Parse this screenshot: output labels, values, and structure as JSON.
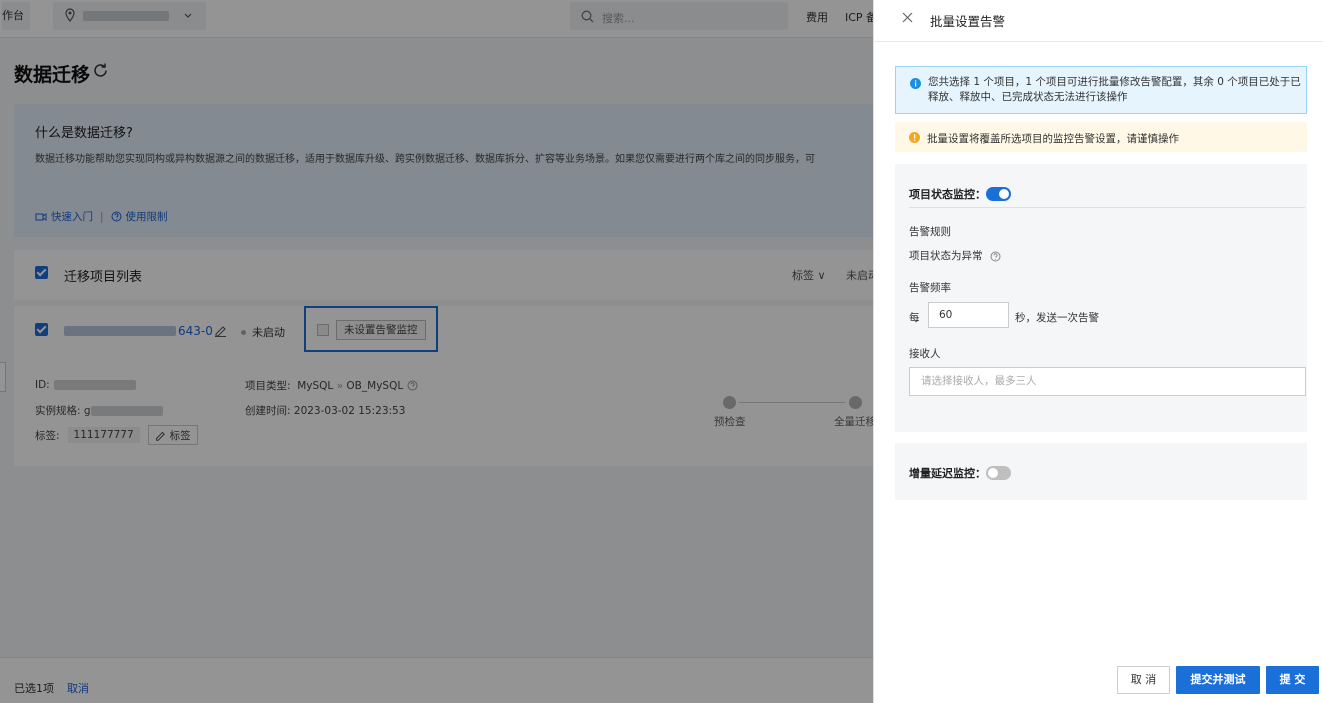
{
  "topbar": {
    "workbench_label": "作台",
    "search_placeholder": "搜索...",
    "fee_label": "费用",
    "icp_label": "ICP 备"
  },
  "page": {
    "title": "数据迁移",
    "intro": {
      "question": "什么是数据迁移?",
      "description": "数据迁移功能帮助您实现同构或异构数据源之间的数据迁移，适用于数据库升级、跨实例数据迁移、数据库拆分、扩容等业务场景。如果您仅需要进行两个库之间的同步服务，可",
      "link_quickstart": "快速入门",
      "link_limits": "使用限制"
    },
    "list": {
      "title": "迁移项目列表",
      "tags_filter": "标签",
      "status_filter": "未启动"
    },
    "project": {
      "name_suffix": "643-0",
      "status": "未启动",
      "alarm_tag": "未设置告警监控",
      "id_label": "ID:",
      "spec_label": "实例规格:",
      "spec_value_prefix": "g",
      "tags_label": "标签:",
      "tags_value": "111177777",
      "tag_button": "标签",
      "type_label": "项目类型:",
      "type_source": "MySQL",
      "type_arrow": "»",
      "type_target": "OB_MySQL",
      "created_label": "创建时间:",
      "created_value": "2023-03-02 15:23:53",
      "step1": "预检查",
      "step2": "全量迁移"
    },
    "footer": {
      "selected": "已选1项",
      "cancel": "取消"
    }
  },
  "drawer": {
    "title": "批量设置告警",
    "info": "您共选择 1 个项目，1 个项目可进行批量修改告警配置，其余 0 个项目已处于已释放、释放中、已完成状态无法进行该操作",
    "warning": "批量设置将覆盖所选项目的监控告警设置，请谨慎操作",
    "status_monitor_label": "项目状态监控：",
    "status_monitor_on": true,
    "rule_label": "告警规则",
    "rule_value": "项目状态为异常",
    "freq_label": "告警频率",
    "freq_prefix": "每",
    "freq_value": "60",
    "freq_suffix": "秒，发送一次告警",
    "receiver_label": "接收人",
    "receiver_placeholder": "请选择接收人，最多三人",
    "delay_monitor_label": "增量延迟监控：",
    "delay_monitor_on": false,
    "btn_cancel": "取 消",
    "btn_submit_test": "提交并测试",
    "btn_submit": "提 交"
  },
  "colors": {
    "primary": "#1a6fd8",
    "info_bg": "#e5f4fd",
    "warn_bg": "#fff8e6",
    "warn_icon": "#f5a623"
  }
}
